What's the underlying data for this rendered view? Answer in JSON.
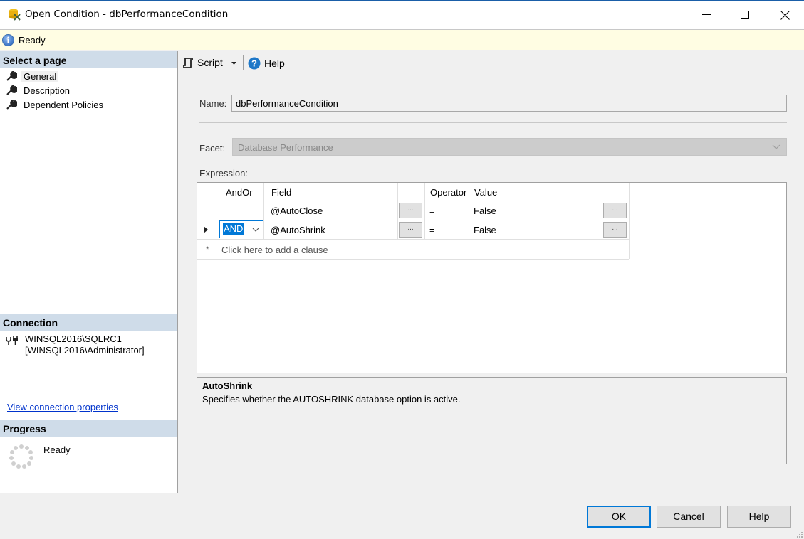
{
  "window": {
    "title": "Open Condition - dbPerformanceCondition",
    "controls": [
      "minimize",
      "maximize",
      "close"
    ]
  },
  "status_bar": {
    "icon": "info-icon",
    "text": "Ready"
  },
  "sidebar": {
    "select_page_header": "Select a page",
    "pages": [
      {
        "label": "General",
        "icon": "wrench-icon",
        "selected": true
      },
      {
        "label": "Description",
        "icon": "wrench-icon",
        "selected": false
      },
      {
        "label": "Dependent Policies",
        "icon": "wrench-icon",
        "selected": false
      }
    ],
    "connection_header": "Connection",
    "connection": {
      "server": "WINSQL2016\\SQLRC1",
      "user": "[WINSQL2016\\Administrator]"
    },
    "view_connection_link": "View connection properties",
    "progress_header": "Progress",
    "progress_status": "Ready"
  },
  "toolbar": {
    "script_label": "Script",
    "help_label": "Help"
  },
  "form": {
    "name_label": "Name:",
    "name_value": "dbPerformanceCondition",
    "facet_label": "Facet:",
    "facet_value": "Database Performance",
    "expression_label": "Expression:"
  },
  "expression_grid": {
    "columns": [
      "AndOr",
      "Field",
      "",
      "Operator",
      "Value",
      ""
    ],
    "rows": [
      {
        "andor": "",
        "field": "@AutoClose",
        "operator": "=",
        "value": "False",
        "current": false
      },
      {
        "andor": "AND",
        "field": "@AutoShrink",
        "operator": "=",
        "value": "False",
        "current": true
      }
    ],
    "ellipsis": "...",
    "new_row_marker": "*",
    "add_clause_text": "Click here to add a clause"
  },
  "description": {
    "title": "AutoShrink",
    "text": "Specifies whether the AUTOSHRINK database option is active."
  },
  "buttons": {
    "ok": "OK",
    "cancel": "Cancel",
    "help": "Help"
  }
}
